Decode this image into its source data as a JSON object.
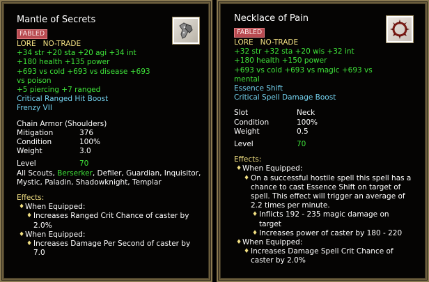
{
  "left": {
    "title": "Mantle of Secrets",
    "icon": "shoulder-armor-icon",
    "badge": "FABLED",
    "flags": [
      "LORE",
      "NO-TRADE"
    ],
    "green_lines": [
      "+34 str  +20 sta  +20 agi  +34 int",
      "+180 health   +135 power",
      "+693 vs cold  +693 vs disease  +693",
      "vs poison",
      "+5 piercing  +7 ranged"
    ],
    "cyan_lines": [
      "Critical Ranged Hit Boost",
      "Frenzy VII"
    ],
    "item_type": "Chain Armor (Shoulders)",
    "stats": [
      {
        "k": "Mitigation",
        "v": "376"
      },
      {
        "k": "Condition",
        "v": "100%"
      },
      {
        "k": "Weight",
        "v": "3.0"
      }
    ],
    "level": {
      "k": "Level",
      "v": "70"
    },
    "classes_pre": "All Scouts, ",
    "classes_highlight": "Berserker",
    "classes_post": ", Defiler, Guardian, Inquisitor,",
    "classes_line2": "Mystic, Paladin, Shadowknight, Templar",
    "effects_label": "Effects:",
    "effects": [
      {
        "when": "When Equipped:",
        "desc": [
          "Increases Ranged Crit Chance of caster by",
          "2.0%"
        ]
      },
      {
        "when": "When Equipped:",
        "desc": [
          "Increases Damage Per Second of caster by",
          "7.0"
        ]
      }
    ]
  },
  "right": {
    "title": "Necklace of Pain",
    "icon": "spiked-necklace-icon",
    "badge": "FABLED",
    "flags": [
      "LORE",
      "NO-TRADE"
    ],
    "green_lines": [
      "+32 str  +32 sta  +20 wis  +32 int",
      "+180 health   +150 power",
      "+693 vs cold  +693 vs magic  +693 vs",
      "mental"
    ],
    "cyan_lines": [
      "Essence Shift",
      "Critical Spell Damage Boost"
    ],
    "stats": [
      {
        "k": "Slot",
        "v": "Neck"
      },
      {
        "k": "Condition",
        "v": "100%"
      },
      {
        "k": "Weight",
        "v": "0.5"
      }
    ],
    "level": {
      "k": "Level",
      "v": "70"
    },
    "effects_label": "Effects:",
    "effect1_when": "When Equipped:",
    "effect1_desc": [
      "On a successful hostile spell this spell has a",
      "chance to cast Essence Shift on target of",
      "spell.  This effect will trigger an average of",
      "2.2 times per minute."
    ],
    "effect1_sub": [
      {
        "text": [
          "Inflicts 192 - 235 magic damage on",
          "target"
        ]
      },
      {
        "text": [
          "Increases power of caster by 180 - 220"
        ]
      }
    ],
    "effect2_when": "When Equipped:",
    "effect2_desc": [
      "Increases Damage Spell Crit Chance of",
      "caster by 2.0%"
    ]
  }
}
